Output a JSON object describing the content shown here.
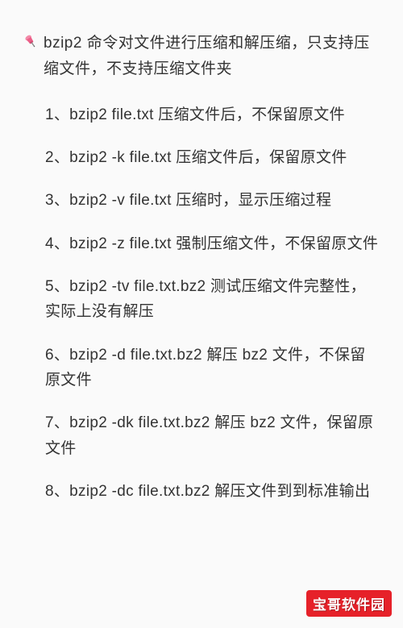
{
  "intro": "bzip2 命令对文件进行压缩和解压缩，只支持压缩文件，不支持压缩文件夹",
  "items": [
    "1、bzip2 file.txt  压缩文件后，不保留原文件",
    "2、bzip2 -k  file.txt  压缩文件后，保留原文件",
    "3、bzip2 -v file.txt  压缩时，显示压缩过程",
    "4、bzip2 -z  file.txt  强制压缩文件，不保留原文件",
    "5、bzip2 -tv  file.txt.bz2  测试压缩文件完整性，实际上没有解压",
    "6、bzip2 -d  file.txt.bz2   解压 bz2 文件，不保留原文件",
    "7、bzip2 -dk  file.txt.bz2   解压 bz2 文件，保留原文件",
    "8、bzip2 -dc file.txt.bz2   解压文件到到标准输出"
  ],
  "watermark": "宝哥软件园"
}
